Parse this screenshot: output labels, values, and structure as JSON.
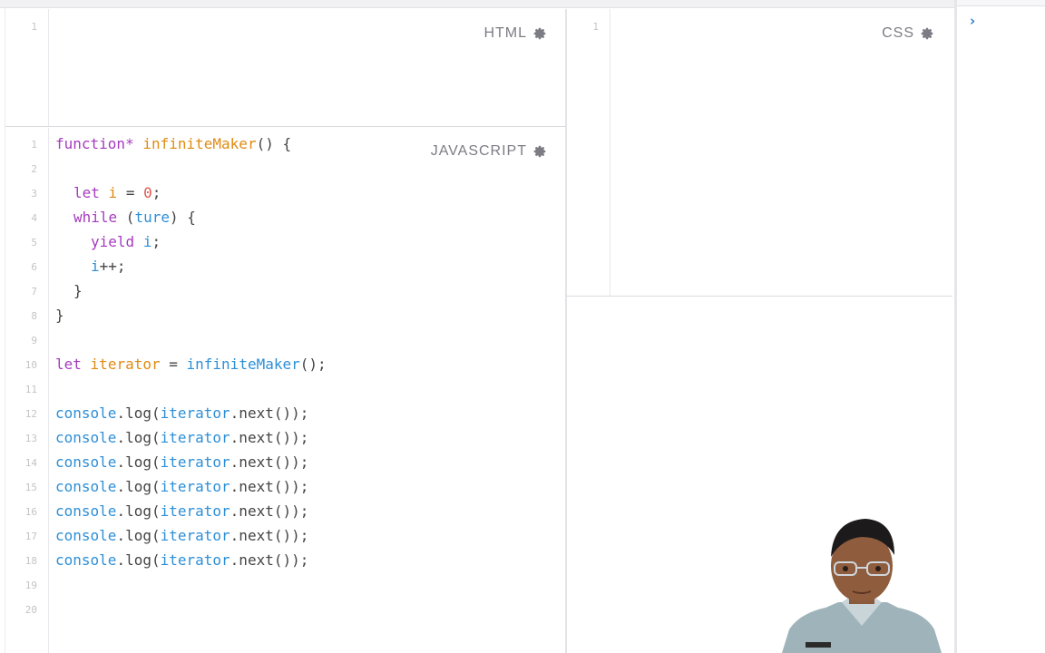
{
  "panes": {
    "html": {
      "label": "HTML",
      "line_numbers": [
        "1"
      ]
    },
    "css": {
      "label": "CSS",
      "line_numbers": [
        "1"
      ]
    },
    "javascript": {
      "label": "JAVASCRIPT",
      "line_numbers": [
        "1",
        "2",
        "3",
        "4",
        "5",
        "6",
        "7",
        "8",
        "9",
        "10",
        "11",
        "12",
        "13",
        "14",
        "15",
        "16",
        "17",
        "18",
        "19",
        "20"
      ]
    }
  },
  "code_tokens": {
    "l1": [
      "function*",
      " ",
      "infiniteMaker",
      "() {"
    ],
    "l3": [
      "let",
      " ",
      "i",
      " = ",
      "0",
      ";"
    ],
    "l4": [
      "while",
      " (",
      "ture",
      ") {"
    ],
    "l5": [
      "yield",
      " ",
      "i",
      ";"
    ],
    "l6": [
      "i",
      "++;"
    ],
    "l7": [
      "}"
    ],
    "l8": [
      "}"
    ],
    "l10": [
      "let",
      " ",
      "iterator",
      " = ",
      "infiniteMaker",
      "();"
    ],
    "log": [
      "console",
      ".log(",
      "iterator",
      ".next());"
    ]
  },
  "console": {
    "prompt_icon": "chevron-right-icon",
    "prompt_glyph": "›"
  },
  "colors": {
    "keyword": "#a63bbf",
    "function_name": "#e08b12",
    "number": "#e0564a",
    "identifier": "#2e8fd6",
    "console_accent": "#2e7bcf"
  }
}
